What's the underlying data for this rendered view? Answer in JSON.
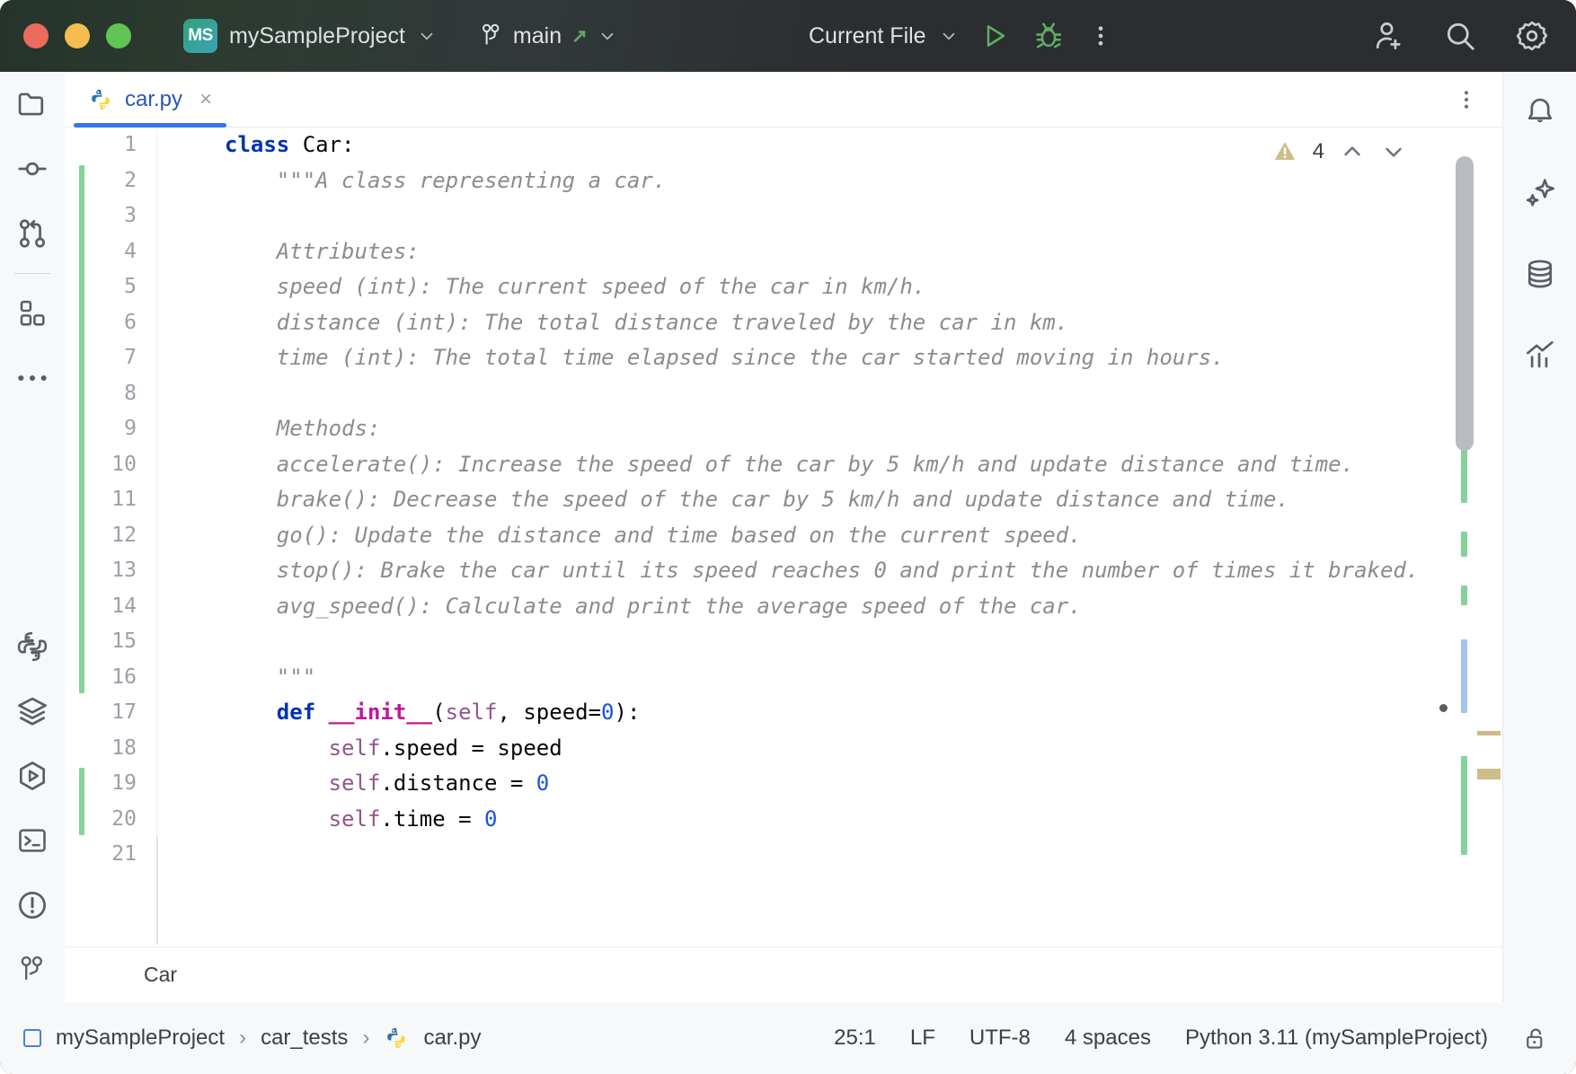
{
  "titlebar": {
    "project_badge": "MS",
    "project_name": "mySampleProject",
    "project_chevron": "chevron-down",
    "branch_name": "main",
    "branch_icon": "vcs-branch",
    "branch_push_arrow": "↗",
    "branch_chevron": "chevron-down",
    "run_config": "Current File",
    "run_config_chevron": "chevron-down",
    "run_button": "run",
    "debug_button": "debug",
    "more_button": "more-vertical",
    "add_user_button": "add-user",
    "search_button": "search",
    "settings_button": "settings"
  },
  "left_rail": [
    {
      "name": "project",
      "icon": "folder"
    },
    {
      "name": "commit",
      "icon": "commit"
    },
    {
      "name": "pull-requests",
      "icon": "pull-request"
    },
    {
      "name": "divider",
      "icon": "divider"
    },
    {
      "name": "plugins",
      "icon": "grid-blocks"
    },
    {
      "name": "more-tool-windows",
      "icon": "ellipsis"
    },
    {
      "name": "python-console",
      "icon": "python"
    },
    {
      "name": "packages",
      "icon": "layers"
    },
    {
      "name": "run",
      "icon": "run-hex"
    },
    {
      "name": "terminal",
      "icon": "terminal"
    },
    {
      "name": "problems",
      "icon": "exclamation-circle"
    },
    {
      "name": "version-control",
      "icon": "vcs-branch"
    }
  ],
  "right_rail": [
    {
      "name": "notifications",
      "icon": "bell"
    },
    {
      "name": "ai-assistant",
      "icon": "sparkle"
    },
    {
      "name": "database",
      "icon": "database"
    },
    {
      "name": "profiler",
      "icon": "chart-up"
    }
  ],
  "tabs": [
    {
      "label": "car.py",
      "icon": "python-file",
      "close": "×",
      "active": true
    }
  ],
  "tab_overflow": "more-vertical",
  "inspections": {
    "icon": "warning-triangle",
    "count": "4",
    "prev": "chevron-up",
    "next": "chevron-down"
  },
  "editor": {
    "first_line": 1,
    "lines": [
      {
        "n": "1",
        "tokens": [
          {
            "t": "class",
            "c": "kw"
          },
          {
            "t": " Car:",
            "c": "pl"
          }
        ],
        "indent": 0,
        "changed": false
      },
      {
        "n": "2",
        "tokens": [
          {
            "t": "\"\"\"A class representing a car.",
            "c": "doc"
          }
        ],
        "indent": 1,
        "changed": true
      },
      {
        "n": "3",
        "tokens": [],
        "indent": 0,
        "changed": true
      },
      {
        "n": "4",
        "tokens": [
          {
            "t": "Attributes:",
            "c": "doc"
          }
        ],
        "indent": 1,
        "changed": true
      },
      {
        "n": "5",
        "tokens": [
          {
            "t": "speed (int): The current speed of the car in km/h.",
            "c": "doc"
          }
        ],
        "indent": 1,
        "changed": true
      },
      {
        "n": "6",
        "tokens": [
          {
            "t": "distance (int): The total distance traveled by the car in km.",
            "c": "doc"
          }
        ],
        "indent": 1,
        "changed": true
      },
      {
        "n": "7",
        "tokens": [
          {
            "t": "time (int): The total time elapsed since the car started moving in hours.",
            "c": "doc"
          }
        ],
        "indent": 1,
        "changed": true
      },
      {
        "n": "8",
        "tokens": [],
        "indent": 0,
        "changed": true
      },
      {
        "n": "9",
        "tokens": [
          {
            "t": "Methods:",
            "c": "doc"
          }
        ],
        "indent": 1,
        "changed": true
      },
      {
        "n": "10",
        "tokens": [
          {
            "t": "accelerate(): Increase the speed of the car by 5 km/h and update distance and time.",
            "c": "doc"
          }
        ],
        "indent": 1,
        "changed": true
      },
      {
        "n": "11",
        "tokens": [
          {
            "t": "brake(): Decrease the speed of the car by 5 km/h and update distance and time.",
            "c": "doc"
          }
        ],
        "indent": 1,
        "changed": true
      },
      {
        "n": "12",
        "tokens": [
          {
            "t": "go(): Update the distance and time based on the current speed.",
            "c": "doc"
          }
        ],
        "indent": 1,
        "changed": true
      },
      {
        "n": "13",
        "tokens": [
          {
            "t": "stop(): Brake the car until its speed reaches 0 and print the number of times it braked.",
            "c": "doc"
          }
        ],
        "indent": 1,
        "changed": true
      },
      {
        "n": "14",
        "tokens": [
          {
            "t": "avg_speed(): Calculate and print the average speed of the car.",
            "c": "doc"
          }
        ],
        "indent": 1,
        "changed": true
      },
      {
        "n": "15",
        "tokens": [],
        "indent": 0,
        "changed": true
      },
      {
        "n": "16",
        "tokens": [
          {
            "t": "\"\"\"",
            "c": "doc"
          }
        ],
        "indent": 1,
        "changed": true
      },
      {
        "n": "17",
        "tokens": [
          {
            "t": "def",
            "c": "kw"
          },
          {
            "t": " ",
            "c": "pl"
          },
          {
            "t": "__init__",
            "c": "fn"
          },
          {
            "t": "(",
            "c": "pl"
          },
          {
            "t": "self",
            "c": "slf"
          },
          {
            "t": ", speed=",
            "c": "pl"
          },
          {
            "t": "0",
            "c": "num"
          },
          {
            "t": "):",
            "c": "pl"
          }
        ],
        "indent": 1,
        "changed": false
      },
      {
        "n": "18",
        "tokens": [
          {
            "t": "self",
            "c": "slf"
          },
          {
            "t": ".speed = speed",
            "c": "pl"
          }
        ],
        "indent": 2,
        "changed": false
      },
      {
        "n": "19",
        "tokens": [
          {
            "t": "self",
            "c": "slf"
          },
          {
            "t": ".distance = ",
            "c": "pl"
          },
          {
            "t": "0",
            "c": "num"
          }
        ],
        "indent": 2,
        "changed": true
      },
      {
        "n": "20",
        "tokens": [
          {
            "t": "self",
            "c": "slf"
          },
          {
            "t": ".time = ",
            "c": "pl"
          },
          {
            "t": "0",
            "c": "num"
          }
        ],
        "indent": 2,
        "changed": true
      },
      {
        "n": "21",
        "tokens": [],
        "indent": 0,
        "changed": false
      }
    ]
  },
  "breadcrumb_strip": "Car",
  "statusbar": {
    "project_icon": "project-square",
    "breadcrumb": [
      "mySampleProject",
      "car_tests",
      "car.py"
    ],
    "separator": "›",
    "file_icon": "python-file",
    "caret": "25:1",
    "line_sep": "LF",
    "encoding": "UTF-8",
    "indent": "4 spaces",
    "interpreter": "Python 3.11 (mySampleProject)",
    "lock_icon": "unlocked-padlock"
  },
  "colors": {
    "titlebar_bg": "#2b2d30",
    "accent_blue": "#3574f0",
    "keyword": "#0033b3",
    "function": "#c4159a",
    "self": "#94558d",
    "number": "#1750eb",
    "docstring": "#8c8c8c",
    "change_green": "#83d49a",
    "warning_tan": "#cdbd8a",
    "run_green": "#5fad65"
  }
}
